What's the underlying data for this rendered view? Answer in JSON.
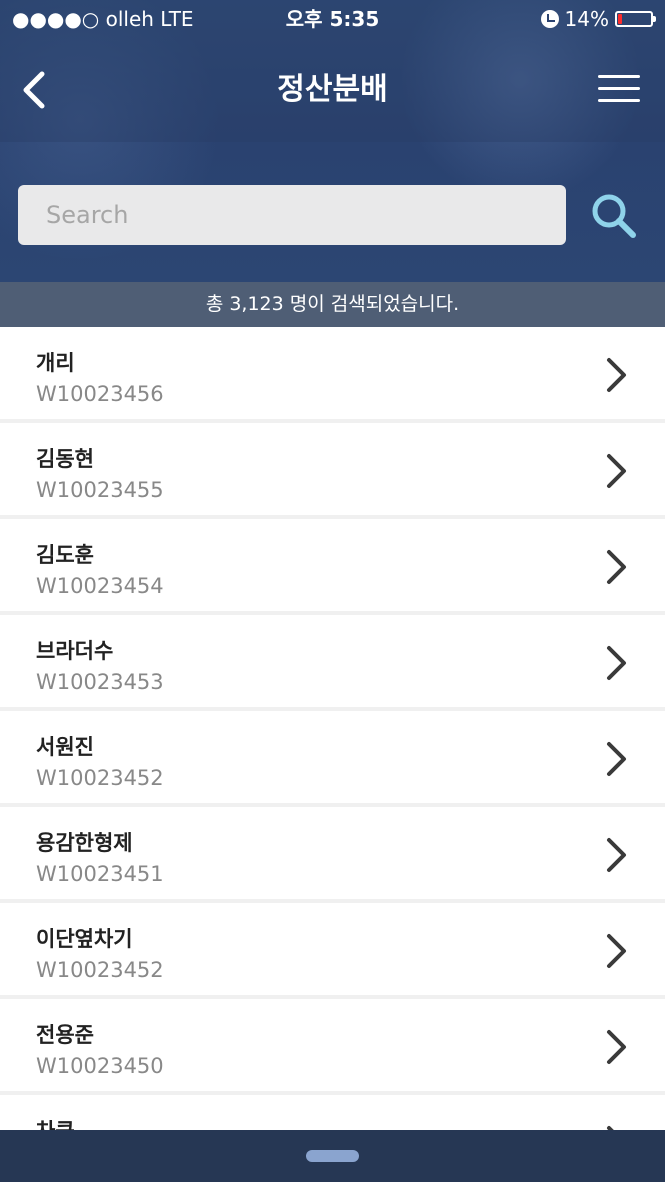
{
  "status_bar": {
    "carrier": "●●●●○ olleh   LTE",
    "time": "오후 5:35",
    "battery": "14%",
    "battery_level": 0.14
  },
  "nav": {
    "title": "정산분배",
    "back_icon": "chevron-left-icon",
    "menu_icon": "hamburger-menu-icon"
  },
  "search": {
    "placeholder": "Search",
    "value": "",
    "icon": "search-icon"
  },
  "result_count": "총 3,123 명이 검색되었습니다.",
  "list": {
    "items": [
      {
        "name": "개리",
        "code": "W10023456"
      },
      {
        "name": "김동현",
        "code": "W10023455"
      },
      {
        "name": "김도훈",
        "code": "W10023454"
      },
      {
        "name": "브라더수",
        "code": "W10023453"
      },
      {
        "name": "서원진",
        "code": "W10023452"
      },
      {
        "name": "용감한형제",
        "code": "W10023451"
      },
      {
        "name": "이단옆차기",
        "code": "W10023452"
      },
      {
        "name": "전용준",
        "code": "W10023450"
      },
      {
        "name": "차쿤",
        "code": ""
      }
    ]
  },
  "colors": {
    "header": "#2c4673",
    "result_bar": "#4f5e75",
    "search_icon": "#8fd3ea",
    "bottom_bar": "#263754"
  }
}
